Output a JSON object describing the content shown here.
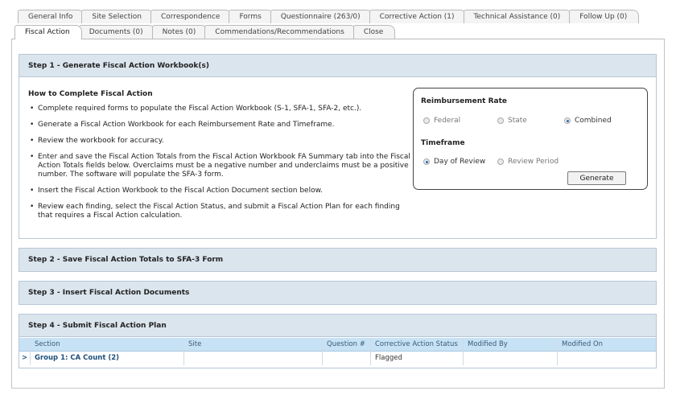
{
  "tabs_row1": [
    "General Info",
    "Site Selection",
    "Correspondence",
    "Forms",
    "Questionnaire (263/0)",
    "Corrective Action (1)",
    "Technical Assistance (0)",
    "Follow Up (0)"
  ],
  "tabs_row2": [
    "Fiscal Action",
    "Documents (0)",
    "Notes (0)",
    "Commendations/Recommendations",
    "Close"
  ],
  "active_tab": "Fiscal Action",
  "step1": {
    "title": "Step 1 - Generate Fiscal Action Workbook(s)",
    "howto_title": "How to Complete Fiscal Action",
    "items": [
      "Complete required forms to populate the Fiscal Action Workbook (S-1, SFA-1, SFA-2, etc.).",
      "Generate a Fiscal Action Workbook for each Reimbursement Rate and Timeframe.",
      "Review the workbook for accuracy.",
      "Enter and save the Fiscal Action Totals from the Fiscal Action Workbook FA Summary tab into the Fiscal Action Totals fields below. Overclaims must be a negative number and underclaims must be a positive number. The software will populate the SFA-3 form.",
      "Insert the Fiscal Action Workbook to the Fiscal Action Document section below.",
      "Review each finding, select the Fiscal Action Status, and submit a Fiscal Action Plan for each finding that requires a Fiscal Action calculation."
    ],
    "reimbursement_title": "Reimbursement Rate",
    "rate_options": [
      "Federal",
      "State",
      "Combined"
    ],
    "rate_selected": "Combined",
    "timeframe_title": "Timeframe",
    "timeframe_options": [
      "Day of Review",
      "Review Period"
    ],
    "timeframe_selected": "Day of Review",
    "generate_label": "Generate"
  },
  "step2": {
    "title": "Step 2 - Save Fiscal Action Totals to SFA-3 Form"
  },
  "step3": {
    "title": "Step 3 - Insert Fiscal Action Documents"
  },
  "step4": {
    "title": "Step 4 - Submit Fiscal Action Plan",
    "columns": [
      "Section",
      "Site",
      "Question #",
      "Corrective Action Status",
      "Modified By",
      "Modified On"
    ],
    "rows": [
      {
        "expander": ">",
        "section": "Group 1: CA Count (2)",
        "site": "",
        "question": "",
        "status": "Flagged",
        "modified_by": "",
        "modified_on": ""
      }
    ]
  }
}
